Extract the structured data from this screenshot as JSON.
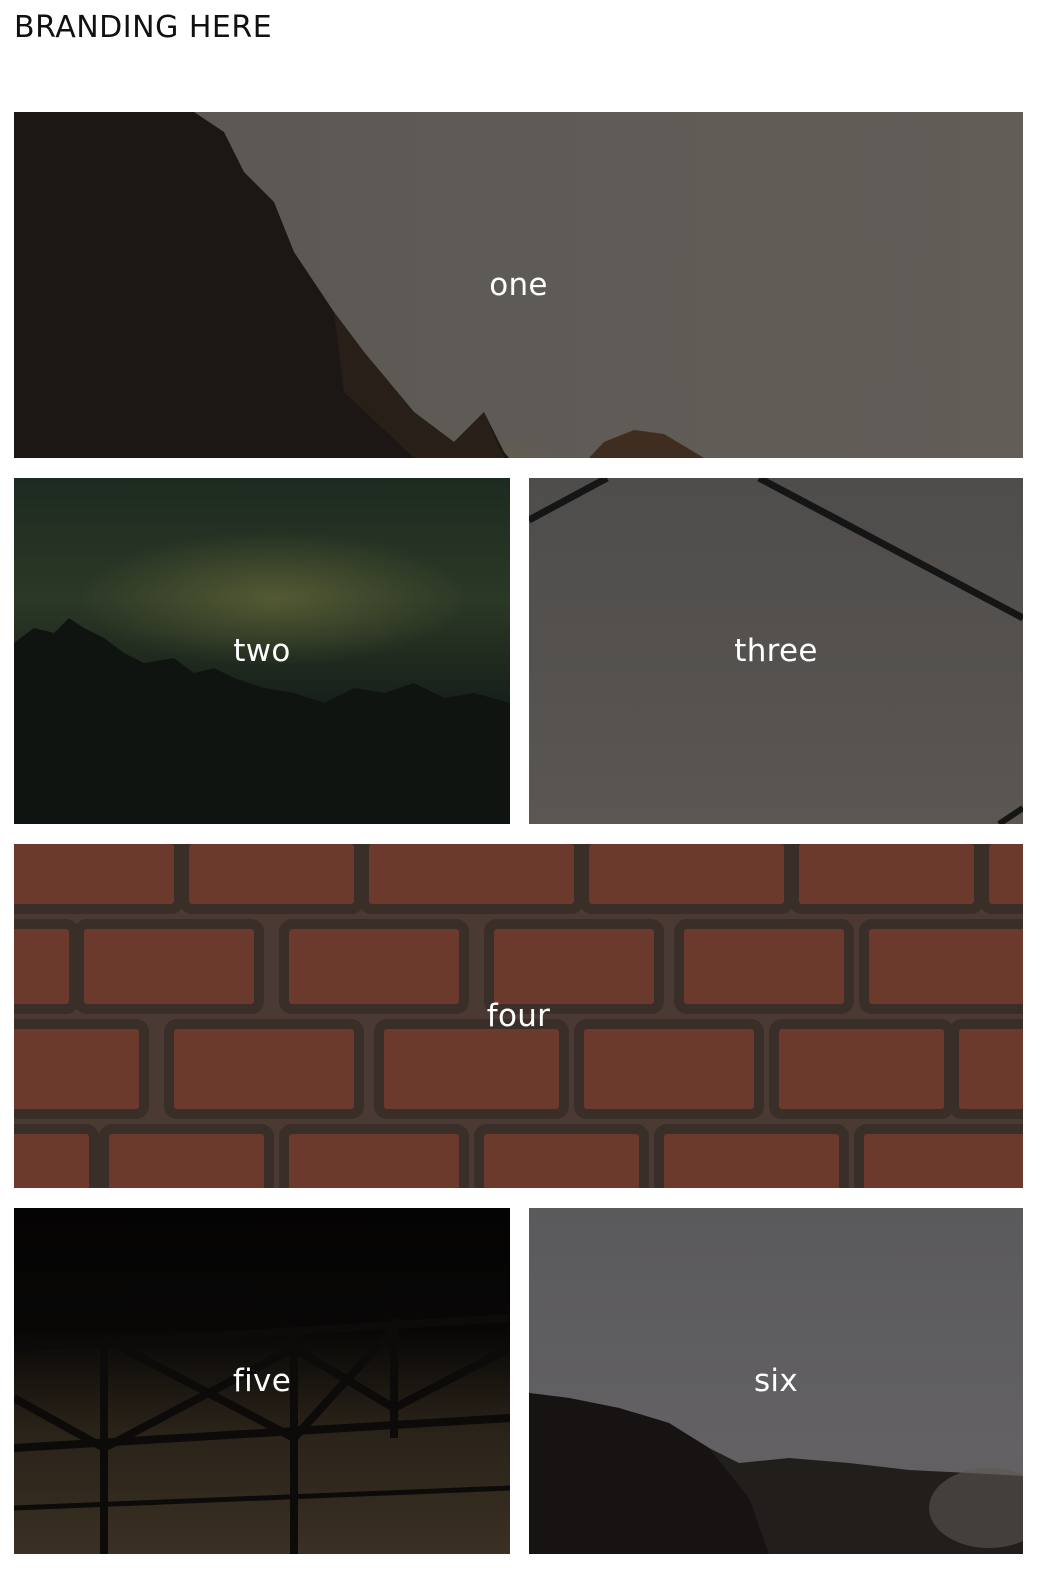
{
  "header": {
    "brand": "BRANDING HERE"
  },
  "tiles": [
    {
      "label": "one"
    },
    {
      "label": "two"
    },
    {
      "label": "three"
    },
    {
      "label": "four"
    },
    {
      "label": "five"
    },
    {
      "label": "six"
    }
  ],
  "colors": {
    "background": "#ffffff",
    "brand_text": "#111111",
    "tile_text": "#ffffff"
  }
}
